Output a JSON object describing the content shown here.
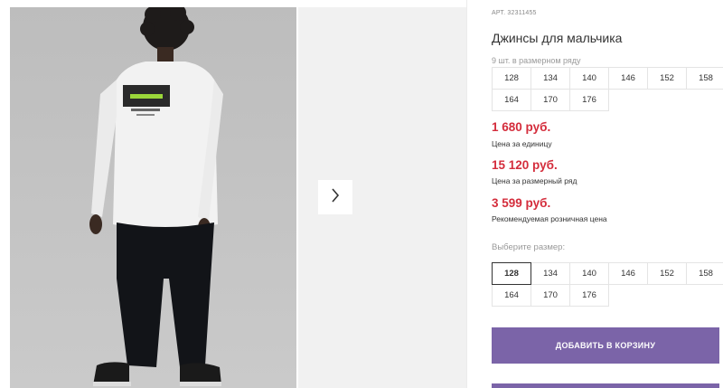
{
  "product": {
    "art": "АРТ. 32311455",
    "title": "Джинсы для мальчика",
    "pack_note": "9 шт. в размерном ряду"
  },
  "pack_sizes": [
    "128",
    "134",
    "140",
    "146",
    "152",
    "158",
    "164",
    "170",
    "176"
  ],
  "prices": [
    {
      "value": "1 680 руб.",
      "label": "Цена за единицу"
    },
    {
      "value": "15 120 руб.",
      "label": "Цена за размерный ряд"
    },
    {
      "value": "3 599 руб.",
      "label": "Рекомендуемая розничная цена"
    }
  ],
  "size_picker": {
    "label": "Выберите размер:",
    "options": [
      "128",
      "134",
      "140",
      "146",
      "152",
      "158",
      "164",
      "170",
      "176"
    ],
    "selected": "128"
  },
  "buttons": {
    "add_to_cart": "ДОБАВИТЬ В КОРЗИНУ"
  },
  "icons": {
    "next": "chevron-right-icon"
  },
  "colors": {
    "price": "#d42d3c",
    "button": "#7b64a8"
  }
}
